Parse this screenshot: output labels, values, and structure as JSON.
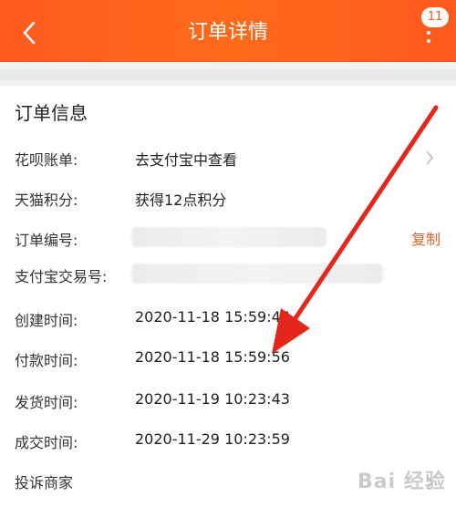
{
  "header": {
    "title": "订单详情",
    "badge_count": "11",
    "back_icon": "chevron-left-icon",
    "more_icon": "more-vertical-icon",
    "background_color": "#ff5a1e"
  },
  "section": {
    "title": "订单信息"
  },
  "rows": [
    {
      "label": "花呗账单:",
      "value": "去支付宝中查看"
    },
    {
      "label": "天猫积分:",
      "value": "获得12点积分"
    },
    {
      "label": "订单编号:",
      "value": "",
      "action": "复制"
    },
    {
      "label": "支付宝交易号:",
      "value": ""
    },
    {
      "label": "创建时间:",
      "value": "2020-11-18 15:59:46"
    },
    {
      "label": "付款时间:",
      "value": "2020-11-18 15:59:56"
    },
    {
      "label": "发货时间:",
      "value": "2020-11-19 10:23:43"
    },
    {
      "label": "成交时间:",
      "value": "2020-11-29 10:23:59"
    },
    {
      "label": "投诉商家",
      "value": ""
    }
  ],
  "accent_color": "#e0652a",
  "annotation_arrow_color": "#e5271b",
  "watermark": {
    "text": "Bai 经验"
  }
}
